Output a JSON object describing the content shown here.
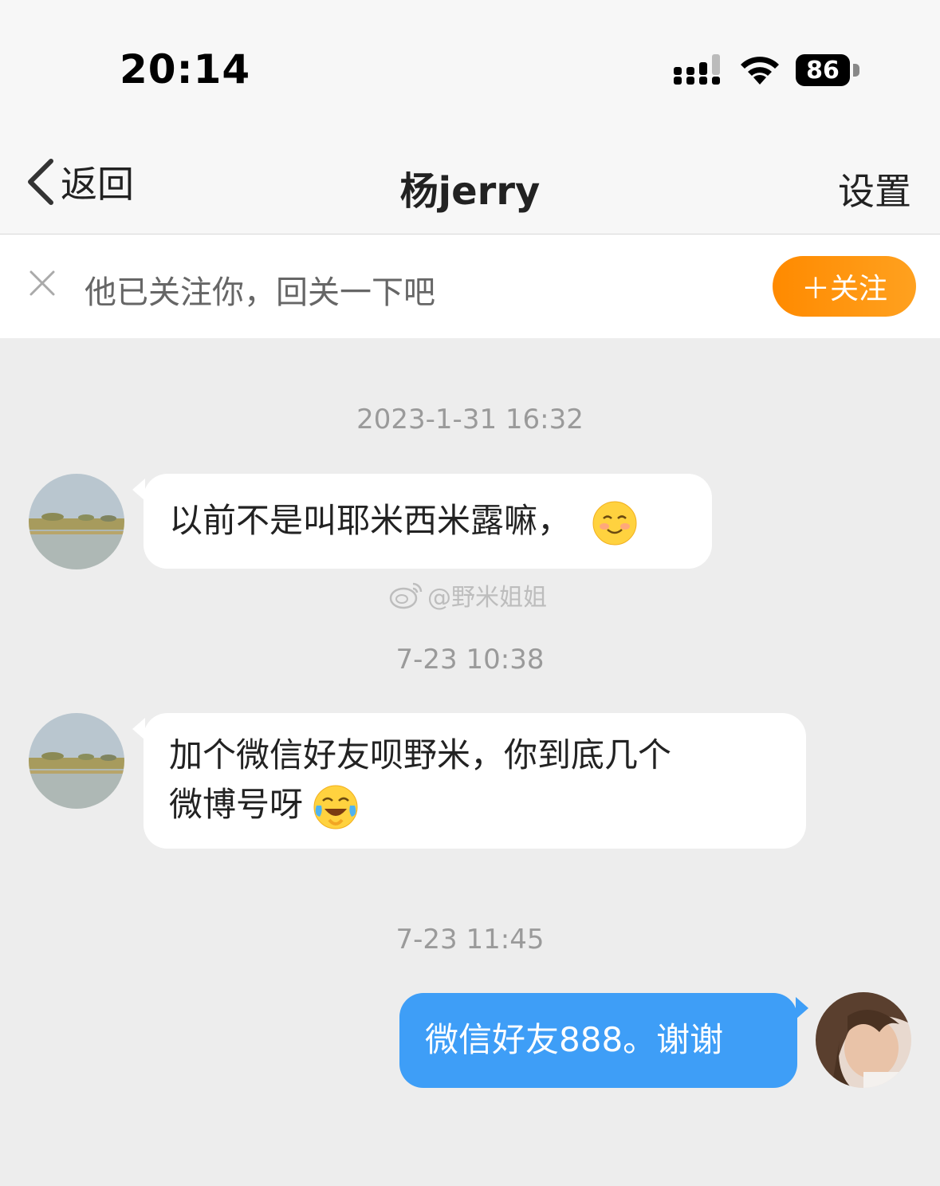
{
  "status_bar": {
    "time": "20:14",
    "battery": "86"
  },
  "nav": {
    "back_label": "返回",
    "title": "杨jerry",
    "settings_label": "设置"
  },
  "follow_banner": {
    "text": "他已关注你，回关一下吧",
    "button_label": "＋关注"
  },
  "messages": [
    {
      "timestamp": "2023-1-31 16:32",
      "direction": "incoming",
      "text": "以前不是叫耶米西米露嘛，",
      "emoji": "smile-blush-emoji"
    },
    {
      "timestamp": "7-23 10:38",
      "direction": "incoming",
      "line1": "加个微信好友呗野米，你到底几个",
      "line2": "微博号呀",
      "emoji": "laugh-cry-emoji"
    },
    {
      "timestamp": "7-23 11:45",
      "direction": "outgoing",
      "text": "微信好友888。谢谢"
    }
  ],
  "watermark": {
    "text": "@野米姐姐",
    "icon": "weibo-logo-icon"
  },
  "colors": {
    "accent_orange": "#ff8a00",
    "outgoing_bubble": "#3e9ef7",
    "background": "#ededed"
  }
}
